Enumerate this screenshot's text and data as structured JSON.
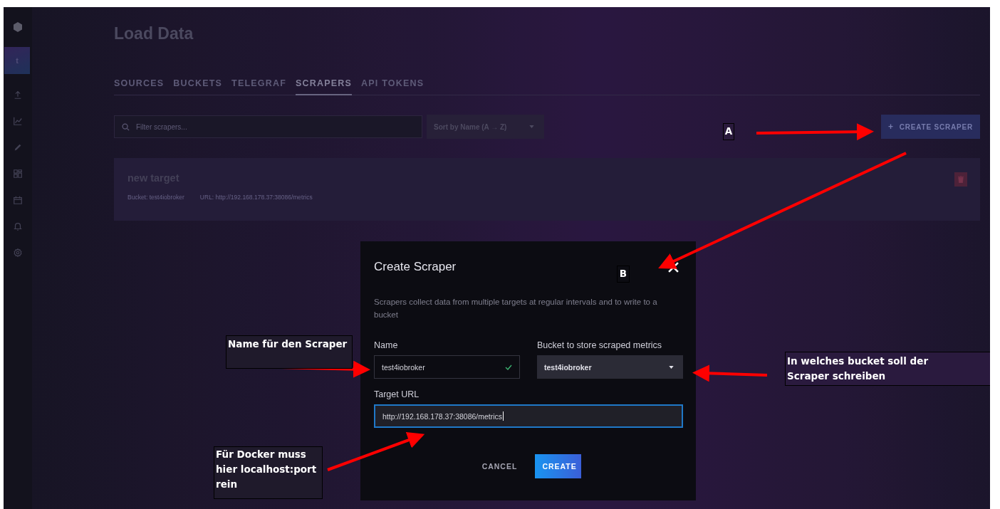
{
  "sidebar": {
    "avatar": "t"
  },
  "page": {
    "title": "Load Data",
    "tabs": [
      {
        "label": "SOURCES",
        "selected": false
      },
      {
        "label": "BUCKETS",
        "selected": false
      },
      {
        "label": "TELEGRAF",
        "selected": false
      },
      {
        "label": "SCRAPERS",
        "selected": true
      },
      {
        "label": "API TOKENS",
        "selected": false
      }
    ],
    "search": {
      "placeholder": "Filter scrapers..."
    },
    "sort": {
      "value": "Sort by Name (A → Z)"
    },
    "create_button": {
      "icon": "+",
      "label": "CREATE SCRAPER"
    },
    "scrapers": [
      {
        "name": "new target",
        "bucket": "Bucket: test4iobroker",
        "url": "URL: http://192.168.178.37:38086/metrics"
      }
    ]
  },
  "dialog": {
    "title": "Create Scraper",
    "description": "Scrapers collect data from multiple targets at regular intervals and to write to a bucket",
    "name_field": {
      "label": "Name",
      "value": "test4iobroker",
      "valid": true
    },
    "bucket_field": {
      "label": "Bucket to store scraped metrics",
      "value": "test4iobroker"
    },
    "url_field": {
      "label": "Target URL",
      "value": "http://192.168.178.37:38086/metrics",
      "focused": true
    },
    "buttons": [
      {
        "label": "CANCEL",
        "kind": "secondary"
      },
      {
        "label": "CREATE",
        "kind": "primary"
      }
    ]
  },
  "annotations": [
    {
      "text": "A"
    },
    {
      "text": "B"
    },
    {
      "text": "Name für den Scraper"
    },
    {
      "text": "In welches bucket soll der Scraper schreiben"
    },
    {
      "text": "Für Docker muss hier localhost:port rein"
    }
  ]
}
